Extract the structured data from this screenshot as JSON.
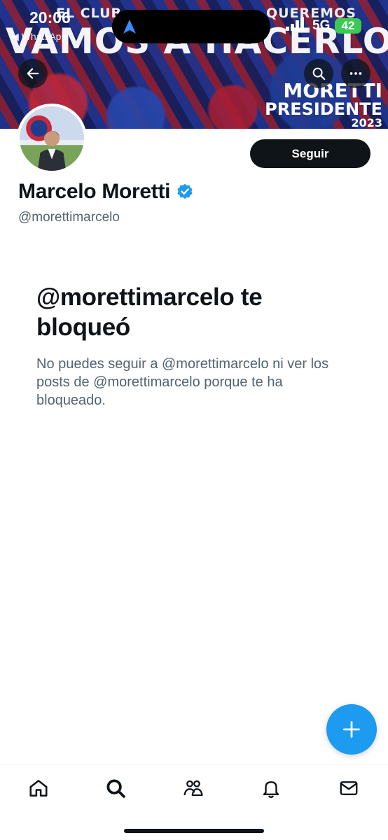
{
  "status_bar": {
    "time": "20:06",
    "back_app": "◀ WhatsApp",
    "network": "5G",
    "battery": "42"
  },
  "banner": {
    "top_left_text": "EL CLUB",
    "top_right_text": "QUEREMOS",
    "slogan": "VAMOS A HACERLO",
    "brand_name": "MORETTI",
    "brand_role": "PRESIDENTE",
    "brand_year": "2023",
    "colors": {
      "blue": "#2a3f9a",
      "red": "#8a2240"
    }
  },
  "profile": {
    "display_name": "Marcelo Moretti",
    "handle": "@morettimarcelo",
    "verified": true,
    "follow_label": "Seguir"
  },
  "blocked": {
    "title": "@morettimarcelo te bloqueó",
    "description": "No puedes seguir a @morettimarcelo ni ver los posts de @morettimarcelo porque te ha bloqueado."
  },
  "icons": {
    "back": "arrow-left-icon",
    "search": "search-icon",
    "more": "more-icon",
    "compose": "plus-icon",
    "nav": [
      "home-icon",
      "search-icon",
      "communities-icon",
      "notifications-icon",
      "messages-icon"
    ]
  },
  "colors": {
    "accent": "#1d9bf0",
    "text": "#0f1419",
    "secondary_text": "#536471",
    "battery": "#3ccb52"
  }
}
